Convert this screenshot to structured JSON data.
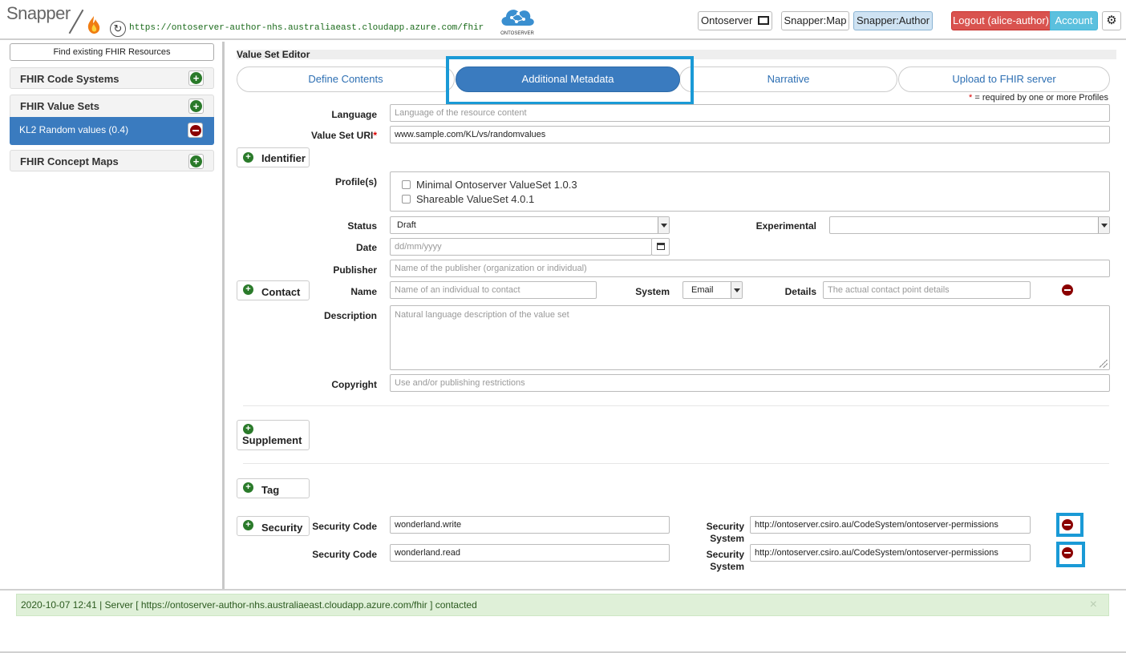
{
  "header": {
    "logo": "Snapper",
    "url": "https://ontoserver-author-nhs.australiaeast.cloudapp.azure.com/fhir",
    "ontoserver_logo": "ONTOSERVER",
    "ontoserver_btn": "Ontoserver",
    "map_btn": "Snapper:Map",
    "author_btn": "Snapper:Author",
    "logout_btn": "Logout (alice-author)",
    "account_btn": "Account"
  },
  "sidebar": {
    "find_btn": "Find existing FHIR Resources",
    "code_systems": "FHIR Code Systems",
    "value_sets": "FHIR Value Sets",
    "active_item": "KL2 Random values (0.4)",
    "concept_maps": "FHIR Concept Maps"
  },
  "editor": {
    "title": "Value Set Editor",
    "tabs": [
      "Define Contents",
      "Additional Metadata",
      "Narrative",
      "Upload to FHIR server"
    ],
    "required_note_star": "*",
    "required_note": " = required by one or more Profiles",
    "language_label": "Language",
    "language_placeholder": "Language of the resource content",
    "uri_label": "Value Set URI",
    "uri_star": "*",
    "uri_value": "www.sample.com/KL/vs/randomvalues",
    "identifier_btn": "Identifier",
    "profiles_label": "Profile(s)",
    "profiles": [
      "Minimal Ontoserver ValueSet 1.0.3",
      "Shareable ValueSet 4.0.1"
    ],
    "status_label": "Status",
    "status_value": "Draft",
    "experimental_label": "Experimental",
    "experimental_value": "",
    "date_label": "Date",
    "date_placeholder": "dd/mm/yyyy",
    "publisher_label": "Publisher",
    "publisher_placeholder": "Name of the publisher (organization or individual)",
    "contact_btn": "Contact",
    "name_label": "Name",
    "name_placeholder": "Name of an individual to contact",
    "system_label": "System",
    "system_value": "Email",
    "details_label": "Details",
    "details_placeholder": "The actual contact point details",
    "description_label": "Description",
    "description_placeholder": "Natural language description of the value set",
    "copyright_label": "Copyright",
    "copyright_placeholder": "Use and/or publishing restrictions",
    "supplement_btn": "Supplement",
    "tag_btn": "Tag",
    "security_btn": "Security",
    "security_rows": [
      {
        "code_label": "Security Code",
        "code": "wonderland.write",
        "system_label_1": "Security",
        "system_label_2": "System",
        "system": "http://ontoserver.csiro.au/CodeSystem/ontoserver-permissions"
      },
      {
        "code_label": "Security Code",
        "code": "wonderland.read",
        "system_label_1": "Security",
        "system_label_2": "System",
        "system": "http://ontoserver.csiro.au/CodeSystem/ontoserver-permissions"
      }
    ]
  },
  "footer": {
    "message": "2020-10-07 12:41 | Server [ https://ontoserver-author-nhs.australiaeast.cloudapp.azure.com/fhir ] contacted",
    "close": "×"
  },
  "colors": {
    "accent": "#3a7bbf",
    "highlight": "#1a9ad6",
    "logout": "#d9534f",
    "account": "#5bc0de",
    "success_bg": "#dff0d8"
  }
}
